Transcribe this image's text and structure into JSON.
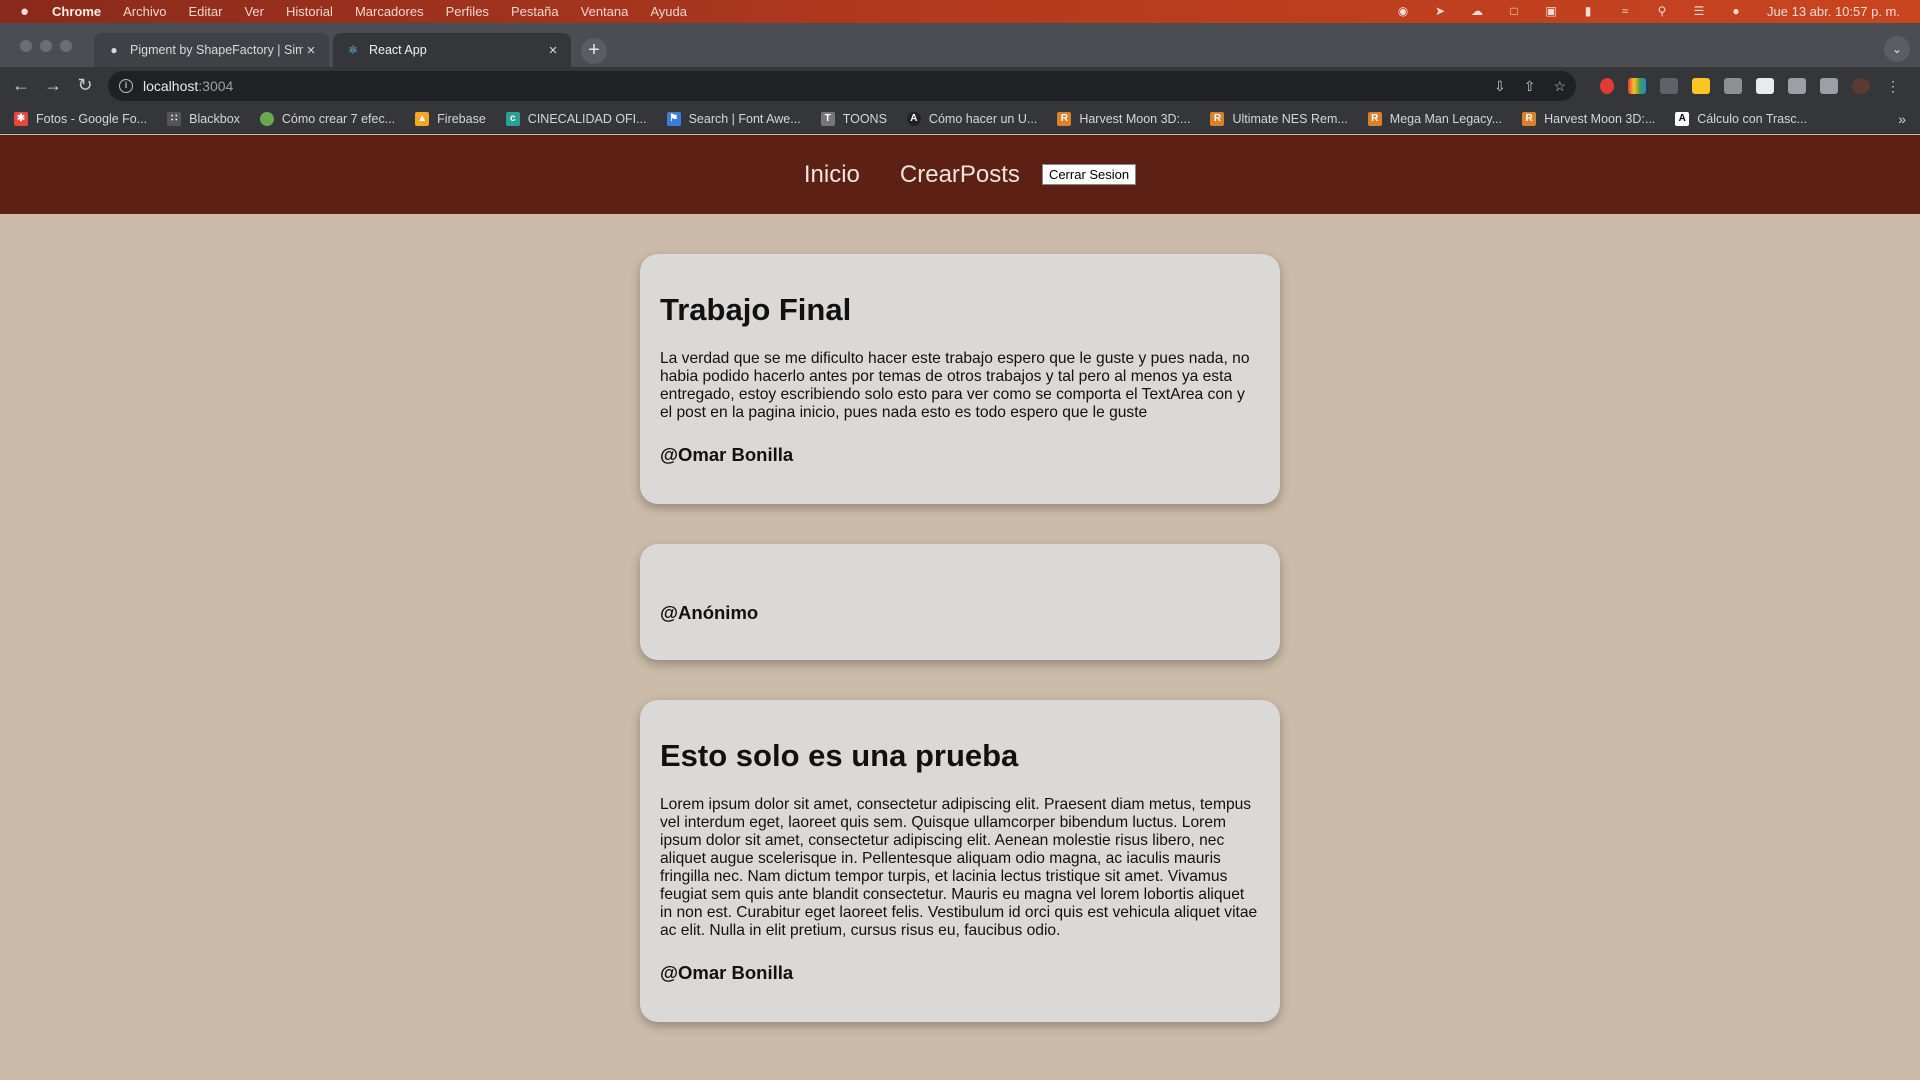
{
  "menubar": {
    "apple": "",
    "app": "Chrome",
    "items": [
      "Archivo",
      "Editar",
      "Ver",
      "Historial",
      "Marcadores",
      "Perfiles",
      "Pestaña",
      "Ventana",
      "Ayuda"
    ],
    "clock": "Jue 13 abr. 10:57 p. m."
  },
  "tabs": [
    {
      "title": "Pigment by ShapeFactory | Sim",
      "icon": "droplet-icon"
    },
    {
      "title": "React App",
      "icon": "react-icon"
    }
  ],
  "omnibox": {
    "host": "localhost",
    "port": ":3004"
  },
  "bookmarks": [
    {
      "label": "Fotos - Google Fo...",
      "icon": "google-photos-icon",
      "color": "#e8453c"
    },
    {
      "label": "Blackbox",
      "icon": "blackbox-icon",
      "color": "#555"
    },
    {
      "label": "Cómo crear 7 efec...",
      "icon": "leaf-icon",
      "color": "#6aa84f"
    },
    {
      "label": "Firebase",
      "icon": "firebase-icon",
      "color": "#f5a623"
    },
    {
      "label": "CINECALIDAD OFI...",
      "icon": "cinecalidad-icon",
      "color": "#2aa198"
    },
    {
      "label": "Search | Font Awe...",
      "icon": "flag-icon",
      "color": "#3b7ddd"
    },
    {
      "label": "TOONS",
      "icon": "toons-icon",
      "color": "#777"
    },
    {
      "label": "Cómo hacer un U...",
      "icon": "circle-a-icon",
      "color": "#222"
    },
    {
      "label": "Harvest Moon 3D:...",
      "icon": "r-icon",
      "color": "#d9822b"
    },
    {
      "label": "Ultimate NES Rem...",
      "icon": "r-icon",
      "color": "#d9822b"
    },
    {
      "label": "Mega Man Legacy...",
      "icon": "r-icon",
      "color": "#d9822b"
    },
    {
      "label": "Harvest Moon 3D:...",
      "icon": "r-icon",
      "color": "#d9822b"
    },
    {
      "label": "Cálculo con Trasc...",
      "icon": "a-icon",
      "color": "#ffffff"
    }
  ],
  "navbar": {
    "home": "Inicio",
    "create": "CrearPosts",
    "logout": "Cerrar Sesion"
  },
  "posts": [
    {
      "title": "Trabajo Final",
      "body": "La verdad que se me dificulto hacer este trabajo espero que le guste y pues nada, no habia podido hacerlo antes por temas de otros trabajos y tal pero al menos ya esta entregado, estoy escribiendo solo esto para ver como se comporta el TextArea con y el post en la pagina inicio, pues nada esto es todo espero que le guste",
      "author": "@Omar Bonilla"
    },
    {
      "title": "",
      "body": "",
      "author": "@Anónimo"
    },
    {
      "title": "Esto solo es una prueba",
      "body": "Lorem ipsum dolor sit amet, consectetur adipiscing elit. Praesent diam metus, tempus vel interdum eget, laoreet quis sem. Quisque ullamcorper bibendum luctus. Lorem ipsum dolor sit amet, consectetur adipiscing elit. Aenean molestie risus libero, nec aliquet augue scelerisque in. Pellentesque aliquam odio magna, ac iaculis mauris fringilla nec. Nam dictum tempor turpis, et lacinia lectus tristique sit amet. Vivamus feugiat sem quis ante blandit consectetur. Mauris eu magna vel lorem lobortis aliquet in non est. Curabitur eget laoreet felis. Vestibulum id orci quis est vehicula aliquet vitae ac elit. Nulla in elit pretium, cursus risus eu, faucibus odio.",
      "author": "@Omar Bonilla"
    }
  ]
}
